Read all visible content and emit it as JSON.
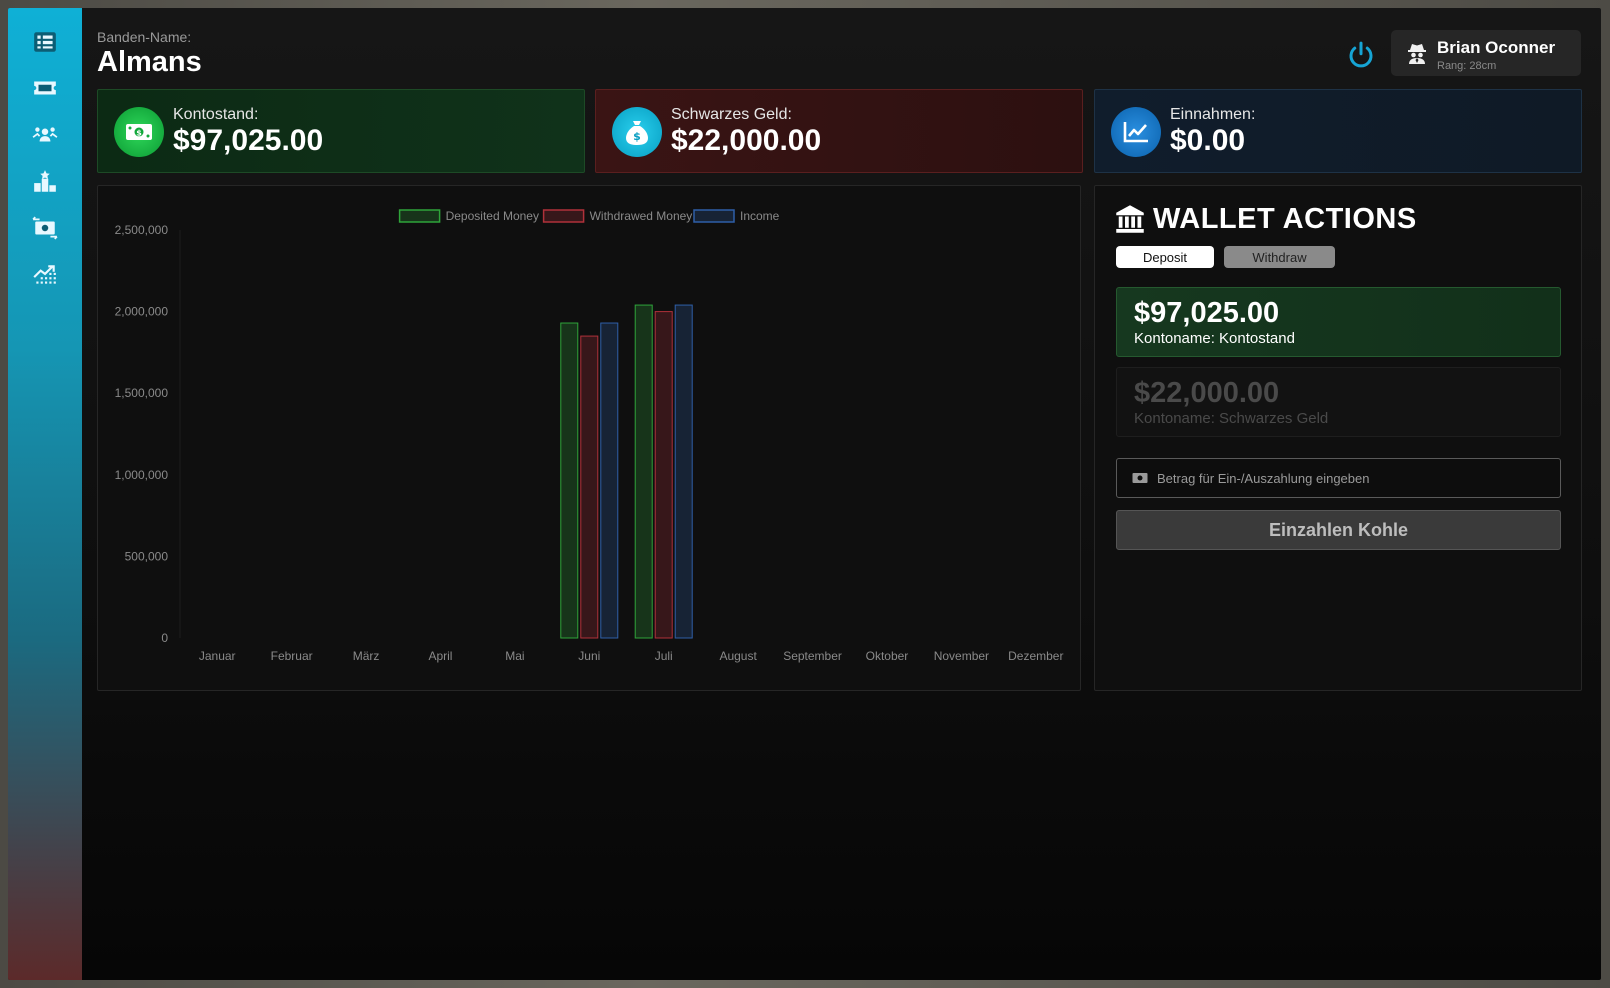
{
  "header": {
    "gang_label": "Banden-Name:",
    "gang_name": "Almans"
  },
  "user": {
    "name": "Brian Oconner",
    "rank": "Rang: 28cm",
    "icon": "spy-icon"
  },
  "sidebar": {
    "items": [
      {
        "name": "list-icon"
      },
      {
        "name": "ticket-icon"
      },
      {
        "name": "group-icon"
      },
      {
        "name": "ranking-icon"
      },
      {
        "name": "money-transfer-icon"
      },
      {
        "name": "stats-icon"
      }
    ]
  },
  "stats": [
    {
      "label": "Kontostand:",
      "value": "$97,025.00",
      "icon": "cash-icon",
      "color": "#18c042"
    },
    {
      "label": "Schwarzes Geld:",
      "value": "$22,000.00",
      "icon": "money-bag-icon",
      "color": "#10b6dc"
    },
    {
      "label": "Einnahmen:",
      "value": "$0.00",
      "icon": "chart-line-icon",
      "color": "#1878c8"
    }
  ],
  "chart_data": {
    "type": "bar",
    "categories": [
      "Januar",
      "Februar",
      "März",
      "April",
      "Mai",
      "Juni",
      "Juli",
      "August",
      "September",
      "Oktober",
      "November",
      "Dezember"
    ],
    "series": [
      {
        "name": "Deposited Money",
        "color": "#2fa43a",
        "values": [
          0,
          0,
          0,
          0,
          0,
          1930000,
          2040000,
          0,
          0,
          0,
          0,
          0
        ]
      },
      {
        "name": "Withdrawed Money",
        "color": "#b0313a",
        "values": [
          0,
          0,
          0,
          0,
          0,
          1850000,
          2000000,
          0,
          0,
          0,
          0,
          0
        ]
      },
      {
        "name": "Income",
        "color": "#2f5fa8",
        "values": [
          0,
          0,
          0,
          0,
          0,
          1930000,
          2040000,
          0,
          0,
          0,
          0,
          0
        ]
      }
    ],
    "yticks": [
      "0",
      "500,000",
      "1,000,000",
      "1,500,000",
      "2,000,000",
      "2,500,000"
    ],
    "ylim": [
      0,
      2500000
    ],
    "legend": "top-center"
  },
  "wallet": {
    "title": "WALLET ACTIONS",
    "tabs": {
      "deposit": "Deposit",
      "withdraw": "Withdraw"
    },
    "accounts": [
      {
        "value": "$97,025.00",
        "name": "Kontoname: Kontostand"
      },
      {
        "value": "$22,000.00",
        "name": "Kontoname: Schwarzes Geld"
      }
    ],
    "amount_placeholder": "Betrag für Ein-/Auszahlung eingeben",
    "submit_label": "Einzahlen Kohle"
  }
}
